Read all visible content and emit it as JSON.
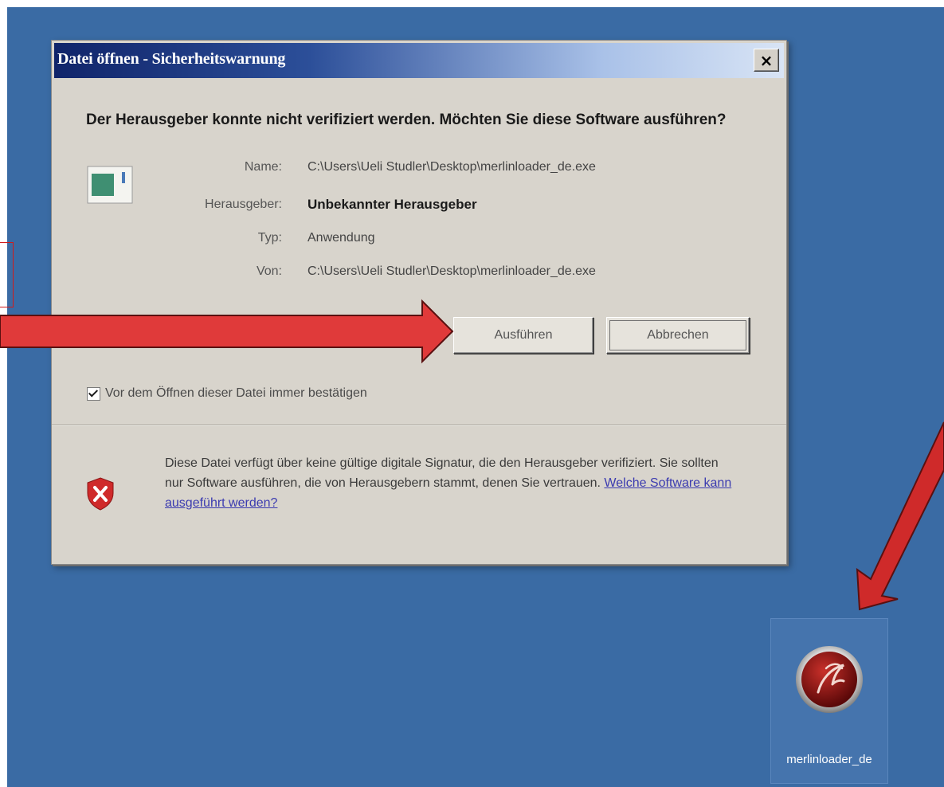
{
  "dialog": {
    "title": "Datei öffnen - Sicherheitswarnung",
    "close_label": "×",
    "question": "Der Herausgeber konnte nicht verifiziert werden. Möchten Sie diese Software ausführen?",
    "fields": {
      "name_label": "Name:",
      "name_value": "C:\\Users\\Ueli Studler\\Desktop\\merlinloader_de.exe",
      "publisher_label": "Herausgeber:",
      "publisher_value": "Unbekannter Herausgeber",
      "type_label": "Typ:",
      "type_value": "Anwendung",
      "from_label": "Von:",
      "from_value": "C:\\Users\\Ueli Studler\\Desktop\\merlinloader_de.exe"
    },
    "buttons": {
      "run_label": "Ausführen",
      "cancel_label": "Abbrechen"
    },
    "checkbox": {
      "label": "Vor dem Öffnen dieser Datei immer bestätigen",
      "checked": true
    },
    "warning": {
      "text": "Diese Datei verfügt über keine gültige digitale Signatur, die den Herausgeber verifiziert. Sie sollten nur Software ausführen, die von Herausgebern stammt, denen Sie vertrauen. ",
      "link": "Welche Software kann ausgeführt werden?"
    }
  },
  "desktop_icon": {
    "label": "merlinloader_de",
    "icon": "merlin-app-icon"
  },
  "annotations": {
    "arrow_color": "#e03a3a",
    "arrow_icon": "red-arrow-icon"
  },
  "colors": {
    "desktop": "#3a6ba4",
    "dialog": "#d8d4cc",
    "titlebar_start": "#10246a"
  }
}
